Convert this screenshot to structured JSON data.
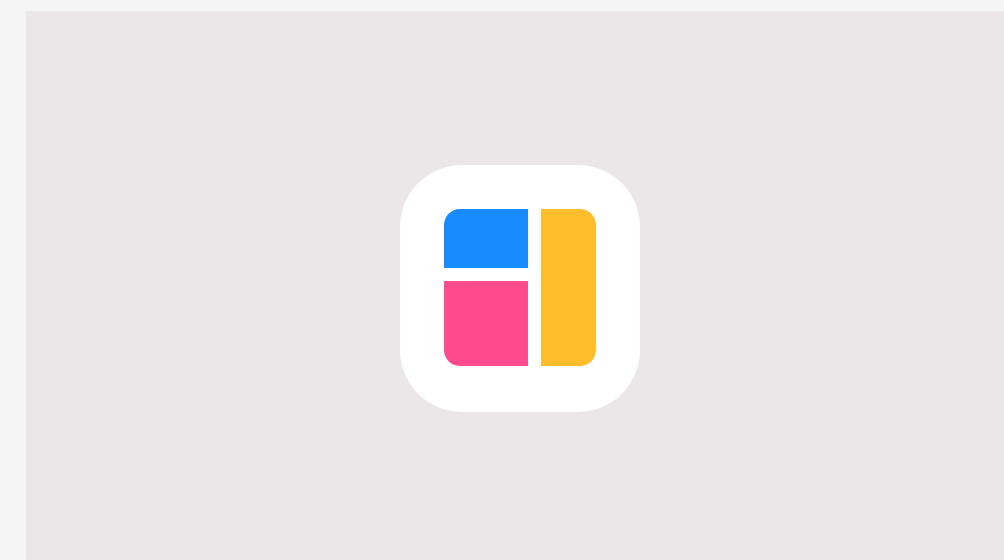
{
  "colors": {
    "page_margin": "#f5f5f5",
    "stage_background": "#ebe6e7",
    "icon_background": "#ffffff",
    "tile_blue": "#178bff",
    "tile_pink": "#ff4a8d",
    "tile_yellow": "#ffbc2b"
  },
  "icon": {
    "name": "collage-layout-app-icon"
  }
}
